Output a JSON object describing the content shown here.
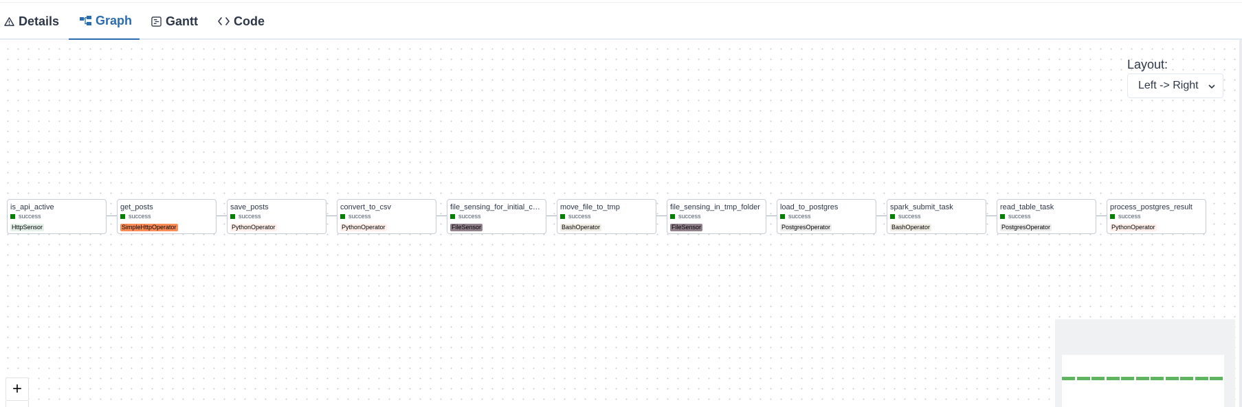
{
  "tabs": [
    {
      "label": "Details",
      "icon": "warning-triangle-icon"
    },
    {
      "label": "Graph",
      "icon": "graph-icon"
    },
    {
      "label": "Gantt",
      "icon": "gantt-icon"
    },
    {
      "label": "Code",
      "icon": "code-icon"
    }
  ],
  "active_tab": "Graph",
  "layout": {
    "label": "Layout:",
    "value": "Left -> Right"
  },
  "nodes": [
    {
      "name": "is_api_active",
      "state": "success",
      "operator": "HttpSensor",
      "op_color": "#e4f0e8"
    },
    {
      "name": "get_posts",
      "state": "success",
      "operator": "SimpleHttpOperator",
      "op_color": "#fa8c56"
    },
    {
      "name": "save_posts",
      "state": "success",
      "operator": "PythonOperator",
      "op_color": "#ffefeb"
    },
    {
      "name": "convert_to_csv",
      "state": "success",
      "operator": "PythonOperator",
      "op_color": "#ffefeb"
    },
    {
      "name": "file_sensing_for_initial_csv...",
      "state": "success",
      "operator": "FileSensor",
      "op_color": "#91818a"
    },
    {
      "name": "move_file_to_tmp",
      "state": "success",
      "operator": "BashOperator",
      "op_color": "#f0ede4"
    },
    {
      "name": "file_sensing_in_tmp_folder",
      "state": "success",
      "operator": "FileSensor",
      "op_color": "#91818a"
    },
    {
      "name": "load_to_postgres",
      "state": "success",
      "operator": "PostgresOperator",
      "op_color": "#ededed"
    },
    {
      "name": "spark_submit_task",
      "state": "success",
      "operator": "BashOperator",
      "op_color": "#f0ede4"
    },
    {
      "name": "read_table_task",
      "state": "success",
      "operator": "PostgresOperator",
      "op_color": "#ededed"
    },
    {
      "name": "process_postgres_result",
      "state": "success",
      "operator": "PythonOperator",
      "op_color": "#ffefeb"
    }
  ],
  "colors": {
    "accent": "#2b6cb0",
    "success": "#008000",
    "edge": "#a3b1c2"
  },
  "controls": {
    "zoom_in": "+"
  }
}
